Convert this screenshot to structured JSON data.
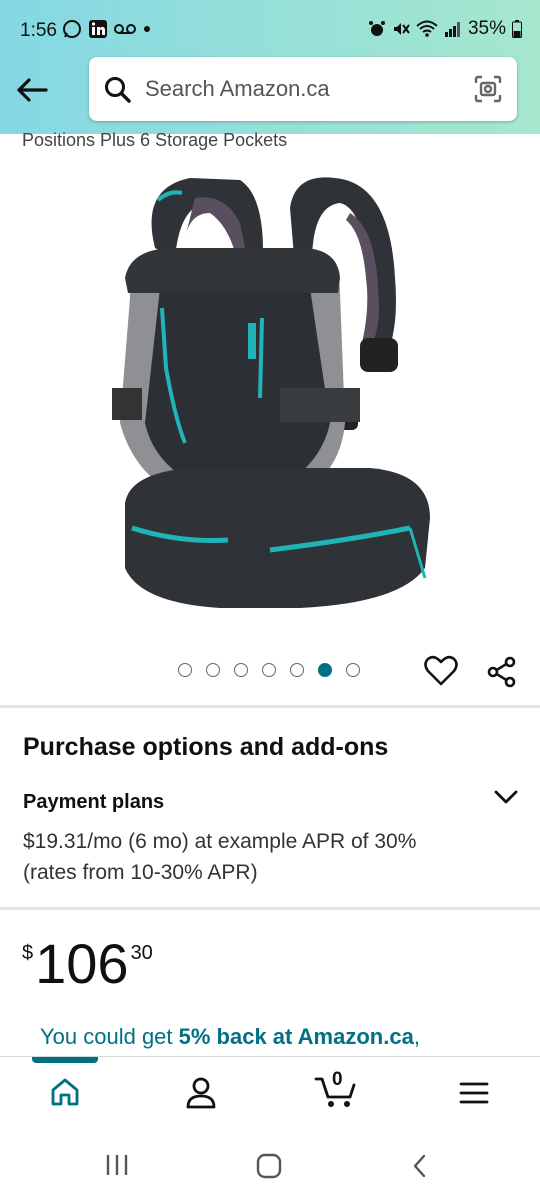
{
  "status_bar": {
    "time": "1:56",
    "battery": "35%",
    "icons_left": [
      "whatsapp-icon",
      "linkedin-icon",
      "voicemail-icon",
      "dot-icon"
    ],
    "icons_right": [
      "alarm-icon",
      "mute-icon",
      "wifi-icon",
      "signal-icon",
      "battery-icon"
    ]
  },
  "header": {
    "search_placeholder": "Search Amazon.ca",
    "back_icon": "arrow-left-icon",
    "camera_icon": "camera-scan-icon"
  },
  "product": {
    "subtitle": "Positions Plus 6 Storage Pockets",
    "image_count": 7,
    "active_image_index": 5
  },
  "purchase": {
    "title": "Purchase options and add-ons",
    "payment_label": "Payment plans",
    "payment_desc": "$19.31/mo (6 mo) at example APR of 30% (rates from 10-30% APR)"
  },
  "price": {
    "symbol": "$",
    "whole": "106",
    "fraction": "30"
  },
  "cashback": {
    "prefix": "You could get ",
    "highlight": "5% back at Amazon.ca",
    "suffix": ","
  },
  "bottom_nav": {
    "cart_count": "0",
    "items": [
      "home-icon",
      "account-icon",
      "cart-icon",
      "menu-icon"
    ]
  },
  "colors": {
    "accent": "#007185",
    "header_start": "#84D8E3",
    "header_end": "#A6E7CE",
    "carrier_teal": "#1FB5B8"
  }
}
